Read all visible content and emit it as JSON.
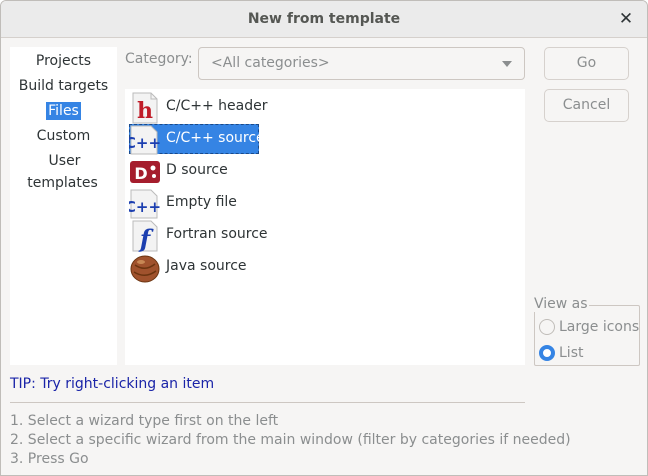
{
  "window": {
    "title": "New from template"
  },
  "sidebar": {
    "items": [
      {
        "label": "Projects"
      },
      {
        "label": "Build targets"
      },
      {
        "label": "Files",
        "selected": true
      },
      {
        "label": "Custom"
      },
      {
        "label": "User templates"
      }
    ]
  },
  "category": {
    "label": "Category:",
    "value": "<All categories>"
  },
  "files": [
    {
      "label": "C/C++ header",
      "icon": "h-header-icon"
    },
    {
      "label": "C/C++ source",
      "icon": "cpp-source-icon",
      "selected": true
    },
    {
      "label": "D source",
      "icon": "d-source-icon"
    },
    {
      "label": "Empty file",
      "icon": "cpp-empty-icon"
    },
    {
      "label": "Fortran source",
      "icon": "fortran-icon"
    },
    {
      "label": "Java source",
      "icon": "java-bean-icon"
    }
  ],
  "buttons": {
    "go": "Go",
    "cancel": "Cancel"
  },
  "view_as": {
    "label": "View as",
    "options": [
      {
        "label": "Large icons",
        "checked": false
      },
      {
        "label": "List",
        "checked": true
      }
    ]
  },
  "tip": "TIP: Try right-clicking an item",
  "instructions": [
    "1. Select a wizard type first on the left",
    "2. Select a specific wizard from the main window (filter by categories if needed)",
    "3. Press Go"
  ],
  "colors": {
    "accent": "#3584e4",
    "tip": "#1a24a8",
    "disabled_text": "#8b8e8f"
  }
}
